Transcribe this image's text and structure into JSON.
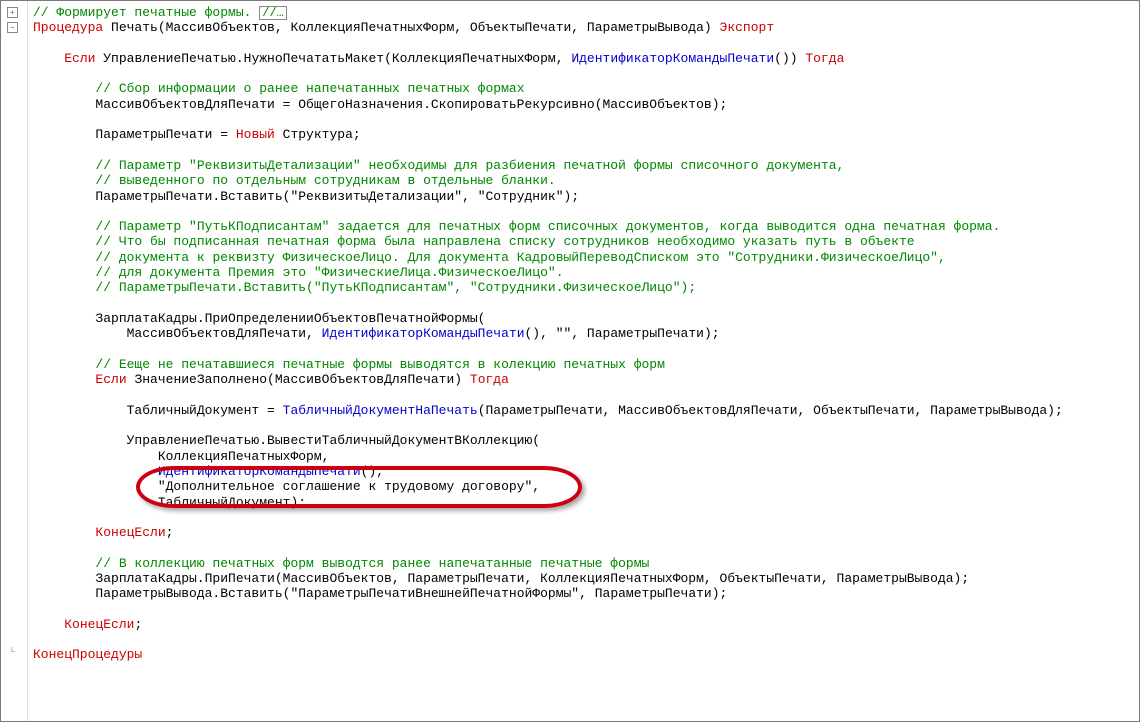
{
  "fold": {
    "plus": "+",
    "minus": "−"
  },
  "lines": [
    [
      {
        "cls": "tok-cm",
        "t": "// Формирует печатные формы. "
      },
      {
        "cls": "boxed",
        "t": "//…"
      }
    ],
    [
      {
        "cls": "tok-kw",
        "t": "Процедура "
      },
      {
        "cls": "tok-pl",
        "t": "Печать(МассивОбъектов, КоллекцияПечатныхФорм, ОбъектыПечати, ПараметрыВывода) "
      },
      {
        "cls": "tok-kw",
        "t": "Экспорт"
      }
    ],
    [
      {
        "cls": "tok-pl",
        "t": ""
      }
    ],
    [
      {
        "cls": "tok-pl",
        "t": "    "
      },
      {
        "cls": "tok-kw",
        "t": "Если "
      },
      {
        "cls": "tok-pl",
        "t": "УправлениеПечатью.НужноПечататьМакет(КоллекцияПечатныхФорм, "
      },
      {
        "cls": "tok-id",
        "t": "ИдентификаторКомандыПечати"
      },
      {
        "cls": "tok-pl",
        "t": "()) "
      },
      {
        "cls": "tok-kw",
        "t": "Тогда"
      }
    ],
    [
      {
        "cls": "tok-pl",
        "t": ""
      }
    ],
    [
      {
        "cls": "tok-pl",
        "t": "        "
      },
      {
        "cls": "tok-cm",
        "t": "// Сбор информации о ранее напечатанных печатных формах"
      }
    ],
    [
      {
        "cls": "tok-pl",
        "t": "        МассивОбъектовДляПечати = ОбщегоНазначения.СкопироватьРекурсивно(МассивОбъектов);"
      }
    ],
    [
      {
        "cls": "tok-pl",
        "t": ""
      }
    ],
    [
      {
        "cls": "tok-pl",
        "t": "        ПараметрыПечати = "
      },
      {
        "cls": "tok-kw",
        "t": "Новый "
      },
      {
        "cls": "tok-pl",
        "t": "Структура;"
      }
    ],
    [
      {
        "cls": "tok-pl",
        "t": ""
      }
    ],
    [
      {
        "cls": "tok-pl",
        "t": "        "
      },
      {
        "cls": "tok-cm",
        "t": "// Параметр \"РеквизитыДетализации\" необходимы для разбиения печатной формы списочного документа,"
      }
    ],
    [
      {
        "cls": "tok-pl",
        "t": "        "
      },
      {
        "cls": "tok-cm",
        "t": "// выведенного по отдельным сотрудникам в отдельные бланки."
      }
    ],
    [
      {
        "cls": "tok-pl",
        "t": "        ПараметрыПечати.Вставить("
      },
      {
        "cls": "tok-str",
        "t": "\"РеквизитыДетализации\""
      },
      {
        "cls": "tok-pl",
        "t": ", "
      },
      {
        "cls": "tok-str",
        "t": "\"Сотрудник\""
      },
      {
        "cls": "tok-pl",
        "t": ");"
      }
    ],
    [
      {
        "cls": "tok-pl",
        "t": ""
      }
    ],
    [
      {
        "cls": "tok-pl",
        "t": "        "
      },
      {
        "cls": "tok-cm",
        "t": "// Параметр \"ПутьКПодписантам\" задается для печатных форм списочных документов, когда выводится одна печатная форма."
      }
    ],
    [
      {
        "cls": "tok-pl",
        "t": "        "
      },
      {
        "cls": "tok-cm",
        "t": "// Что бы подписанная печатная форма была направлена списку сотрудников необходимо указать путь в объекте"
      }
    ],
    [
      {
        "cls": "tok-pl",
        "t": "        "
      },
      {
        "cls": "tok-cm",
        "t": "// документа к реквизту ФизическоеЛицо. Для документа КадровыйПереводСписком это \"Сотрудники.ФизическоеЛицо\","
      }
    ],
    [
      {
        "cls": "tok-pl",
        "t": "        "
      },
      {
        "cls": "tok-cm",
        "t": "// для документа Премия это \"ФизическиеЛица.ФизическоеЛицо\"."
      }
    ],
    [
      {
        "cls": "tok-pl",
        "t": "        "
      },
      {
        "cls": "tok-cm",
        "t": "// ПараметрыПечати.Вставить(\"ПутьКПодписантам\", \"Сотрудники.ФизическоеЛицо\");"
      }
    ],
    [
      {
        "cls": "tok-pl",
        "t": ""
      }
    ],
    [
      {
        "cls": "tok-pl",
        "t": "        ЗарплатаКадры.ПриОпределенииОбъектовПечатнойФормы("
      }
    ],
    [
      {
        "cls": "tok-pl",
        "t": "            МассивОбъектовДляПечати, "
      },
      {
        "cls": "tok-id",
        "t": "ИдентификаторКомандыПечати"
      },
      {
        "cls": "tok-pl",
        "t": "(), "
      },
      {
        "cls": "tok-str",
        "t": "\"\""
      },
      {
        "cls": "tok-pl",
        "t": ", ПараметрыПечати);"
      }
    ],
    [
      {
        "cls": "tok-pl",
        "t": ""
      }
    ],
    [
      {
        "cls": "tok-pl",
        "t": "        "
      },
      {
        "cls": "tok-cm",
        "t": "// Ееще не печатавшиеся печатные формы выводятся в колекцию печатных форм"
      }
    ],
    [
      {
        "cls": "tok-pl",
        "t": "        "
      },
      {
        "cls": "tok-kw",
        "t": "Если "
      },
      {
        "cls": "tok-pl",
        "t": "ЗначениеЗаполнено(МассивОбъектовДляПечати) "
      },
      {
        "cls": "tok-kw",
        "t": "Тогда"
      }
    ],
    [
      {
        "cls": "tok-pl",
        "t": ""
      }
    ],
    [
      {
        "cls": "tok-pl",
        "t": "            ТабличныйДокумент = "
      },
      {
        "cls": "tok-id",
        "t": "ТабличныйДокументНаПечать"
      },
      {
        "cls": "tok-pl",
        "t": "(ПараметрыПечати, МассивОбъектовДляПечати, ОбъектыПечати, ПараметрыВывода);"
      }
    ],
    [
      {
        "cls": "tok-pl",
        "t": ""
      }
    ],
    [
      {
        "cls": "tok-pl",
        "t": "            УправлениеПечатью.ВывестиТабличныйДокументВКоллекцию("
      }
    ],
    [
      {
        "cls": "tok-pl",
        "t": "                КоллекцияПечатныхФорм,"
      }
    ],
    [
      {
        "cls": "tok-pl",
        "t": "                "
      },
      {
        "cls": "tok-id",
        "t": "ИдентификаторКомандыПечати"
      },
      {
        "cls": "tok-pl",
        "t": "(),"
      }
    ],
    [
      {
        "cls": "tok-pl",
        "t": "                "
      },
      {
        "cls": "tok-str",
        "t": "\"Дополнительное соглашение к трудовому договору\""
      },
      {
        "cls": "tok-pl",
        "t": ","
      }
    ],
    [
      {
        "cls": "tok-pl",
        "t": "                ТабличныйДокумент);"
      }
    ],
    [
      {
        "cls": "tok-pl",
        "t": ""
      }
    ],
    [
      {
        "cls": "tok-pl",
        "t": "        "
      },
      {
        "cls": "tok-kw",
        "t": "КонецЕсли"
      },
      {
        "cls": "tok-pl",
        "t": ";"
      }
    ],
    [
      {
        "cls": "tok-pl",
        "t": ""
      }
    ],
    [
      {
        "cls": "tok-pl",
        "t": "        "
      },
      {
        "cls": "tok-cm",
        "t": "// В коллекцию печатных форм выводтся ранее напечатанные печатные формы"
      }
    ],
    [
      {
        "cls": "tok-pl",
        "t": "        ЗарплатаКадры.ПриПечати(МассивОбъектов, ПараметрыПечати, КоллекцияПечатныхФорм, ОбъектыПечати, ПараметрыВывода);"
      }
    ],
    [
      {
        "cls": "tok-pl",
        "t": "        ПараметрыВывода.Вставить("
      },
      {
        "cls": "tok-str",
        "t": "\"ПараметрыПечатиВнешнейПечатнойФормы\""
      },
      {
        "cls": "tok-pl",
        "t": ", ПараметрыПечати);"
      }
    ],
    [
      {
        "cls": "tok-pl",
        "t": ""
      }
    ],
    [
      {
        "cls": "tok-pl",
        "t": "    "
      },
      {
        "cls": "tok-kw",
        "t": "КонецЕсли"
      },
      {
        "cls": "tok-pl",
        "t": ";"
      }
    ],
    [
      {
        "cls": "tok-pl",
        "t": ""
      }
    ],
    [
      {
        "cls": "tok-kw",
        "t": "КонецПроцедуры"
      }
    ]
  ],
  "highlight_line_index": 31
}
